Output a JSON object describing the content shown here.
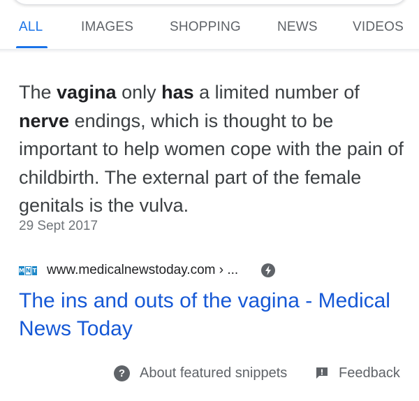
{
  "tabs": [
    {
      "label": "ALL",
      "active": true
    },
    {
      "label": "IMAGES",
      "active": false
    },
    {
      "label": "SHOPPING",
      "active": false
    },
    {
      "label": "NEWS",
      "active": false
    },
    {
      "label": "VIDEOS",
      "active": false
    }
  ],
  "snippet": {
    "segments": [
      {
        "text": "The ",
        "bold": false
      },
      {
        "text": "vagina",
        "bold": true
      },
      {
        "text": " only ",
        "bold": false
      },
      {
        "text": "has",
        "bold": true
      },
      {
        "text": " a limited number of ",
        "bold": false
      },
      {
        "text": "nerve",
        "bold": true
      },
      {
        "text": " endings, which is thought to be important to help women cope with the pain of childbirth. The external part of the female genitals is the vulva.",
        "bold": false
      }
    ],
    "date": "29 Sept 2017"
  },
  "source": {
    "favicon_letters": [
      "M",
      "N",
      "T"
    ],
    "url": "www.medicalnewstoday.com › ...",
    "amp_icon": "amp-bolt-icon"
  },
  "result": {
    "title": "The ins and outs of the vagina - Medical News Today"
  },
  "footer": {
    "about_label": "About featured snippets",
    "feedback_label": "Feedback"
  },
  "colors": {
    "accent": "#1a73e8",
    "link": "#1558d6",
    "muted": "#5f6368"
  }
}
